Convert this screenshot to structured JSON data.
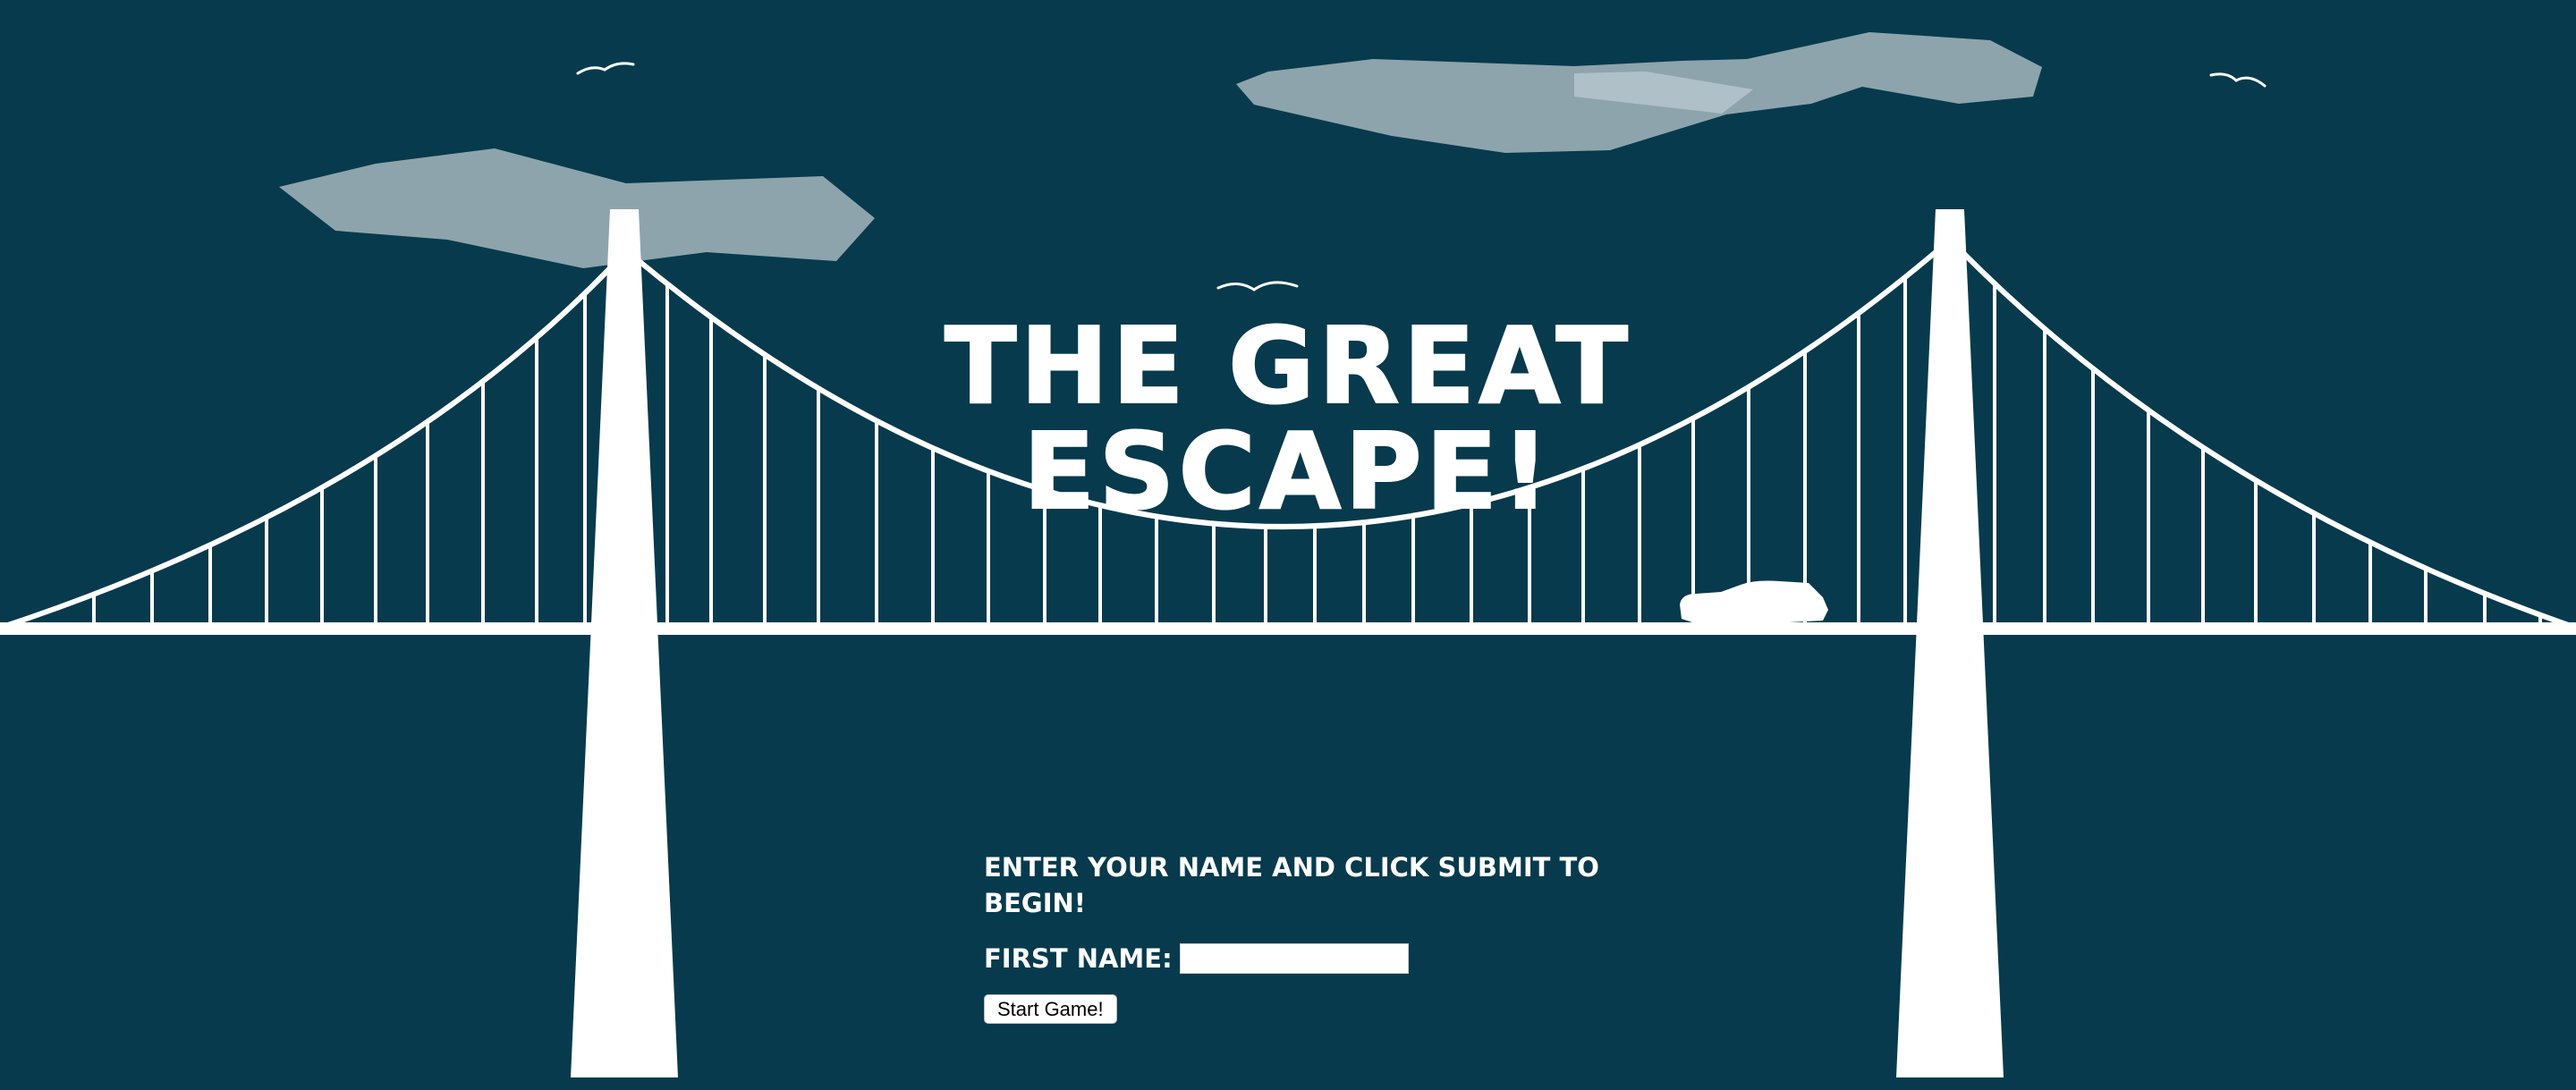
{
  "game": {
    "title": "The Great Escape!"
  },
  "form": {
    "instructions": "Enter your name and click submit to begin!",
    "name_label": "First Name:",
    "name_value": "",
    "start_label": "Start Game!"
  },
  "colors": {
    "sky": "#073a4c",
    "bridge": "#ffffff",
    "cloud": "#8da4ad",
    "cloud_highlight": "#b6c6cc"
  },
  "scene": {
    "elements": [
      "clouds",
      "birds",
      "suspension-bridge",
      "car-silhouette"
    ]
  }
}
